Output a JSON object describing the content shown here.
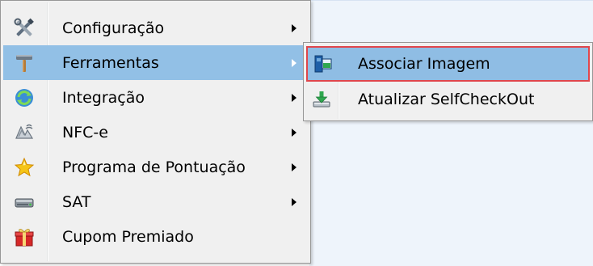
{
  "main_menu": {
    "items": [
      {
        "label": "Configuração",
        "icon": "tools-icon",
        "has_submenu": true
      },
      {
        "label": "Ferramentas",
        "icon": "hammer-icon",
        "has_submenu": true,
        "highlighted": true
      },
      {
        "label": "Integração",
        "icon": "sync-icon",
        "has_submenu": true
      },
      {
        "label": "NFC-e",
        "icon": "signal-icon",
        "has_submenu": true
      },
      {
        "label": "Programa de Pontuação",
        "icon": "star-icon",
        "has_submenu": true
      },
      {
        "label": "SAT",
        "icon": "device-icon",
        "has_submenu": true
      },
      {
        "label": "Cupom Premiado",
        "icon": "gift-icon",
        "has_submenu": false
      }
    ]
  },
  "sub_menu": {
    "items": [
      {
        "label": "Associar Imagem",
        "icon": "image-link-icon",
        "highlighted": true
      },
      {
        "label": "Atualizar SelfCheckOut",
        "icon": "download-icon"
      }
    ]
  },
  "colors": {
    "menu_bg": "#f0f0f0",
    "highlight_bg": "#92c0e6",
    "focus_border": "#e0464c",
    "star": "#f5c518",
    "gift": "#d62828"
  }
}
